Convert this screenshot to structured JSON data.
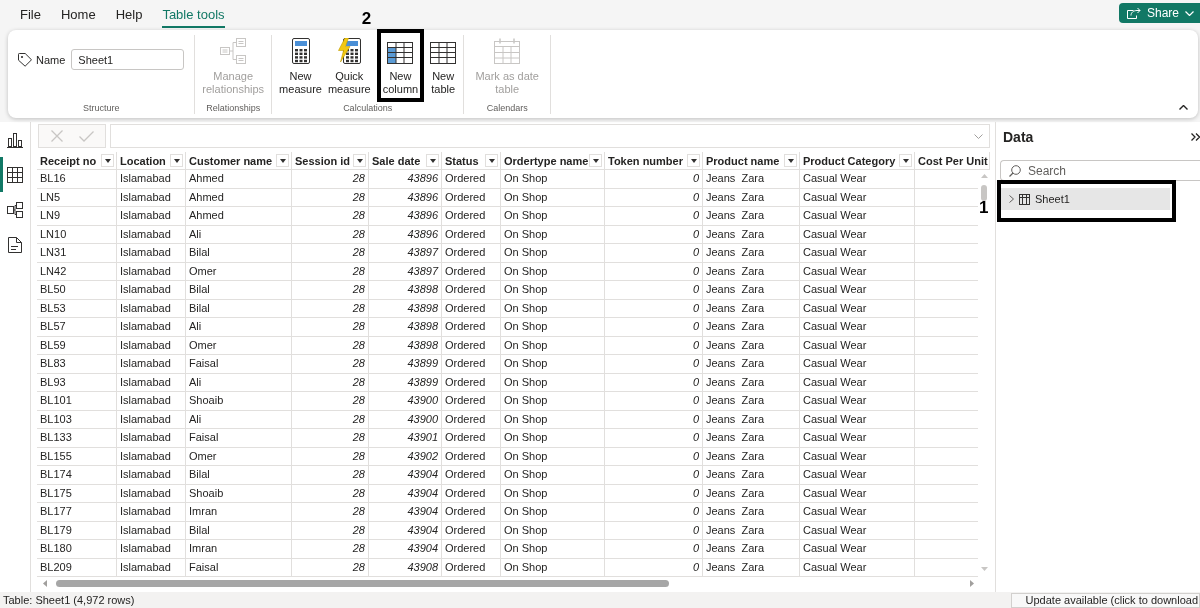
{
  "menu_tabs": [
    {
      "label": "File",
      "selected": false
    },
    {
      "label": "Home",
      "selected": false
    },
    {
      "label": "Help",
      "selected": false
    },
    {
      "label": "Table tools",
      "selected": true
    }
  ],
  "share_button": {
    "label": "Share"
  },
  "ribbon": {
    "groups": [
      {
        "title": "Structure",
        "kind": "field",
        "field": {
          "label": "Name",
          "value": "Sheet1"
        }
      },
      {
        "title": "Relationships",
        "kind": "buttons",
        "buttons": [
          {
            "kind": "relationships",
            "label": "Manage relationships",
            "disabled": true
          }
        ]
      },
      {
        "title": "Calculations",
        "kind": "buttons",
        "buttons": [
          {
            "kind": "measure",
            "label": "New measure",
            "disabled": false
          },
          {
            "kind": "quick",
            "label": "Quick measure",
            "disabled": false
          },
          {
            "kind": "column",
            "label": "New column",
            "disabled": false,
            "annotation": "2"
          },
          {
            "kind": "table",
            "label": "New table",
            "disabled": false
          }
        ]
      },
      {
        "title": "Calendars",
        "kind": "buttons",
        "buttons": [
          {
            "kind": "calendar",
            "label": "Mark as date table",
            "disabled": true
          }
        ]
      }
    ]
  },
  "views": [
    {
      "kind": "report",
      "selected": false
    },
    {
      "kind": "table",
      "selected": true
    },
    {
      "kind": "model",
      "selected": false
    },
    {
      "kind": "dax",
      "selected": false
    }
  ],
  "formula_bar": {
    "buttons": [
      {
        "kind": "cancel",
        "disabled": true
      },
      {
        "kind": "commit",
        "disabled": true
      }
    ]
  },
  "table": {
    "columns": [
      {
        "label": "Receipt no",
        "kind": "text",
        "filter_button": true
      },
      {
        "label": "Location",
        "kind": "text",
        "filter_button": true
      },
      {
        "label": "Customer name",
        "kind": "text",
        "filter_button": true
      },
      {
        "label": "Session id",
        "kind": "number",
        "filter_button": true
      },
      {
        "label": "Sale date",
        "kind": "number",
        "filter_button": true
      },
      {
        "label": "Status",
        "kind": "text",
        "filter_button": true
      },
      {
        "label": "Ordertype name",
        "kind": "text",
        "filter_button": true
      },
      {
        "label": "Token number",
        "kind": "number",
        "filter_button": true
      },
      {
        "label": "Product name",
        "kind": "text",
        "filter_button": true
      },
      {
        "label": "Product Category",
        "kind": "text",
        "filter_button": true
      },
      {
        "label": "Cost Per Unit",
        "kind": "number",
        "filter_button": false
      }
    ],
    "rows": [
      [
        "BL16",
        "Islamabad",
        "Ahmed",
        "28",
        "43896",
        "Ordered",
        "On Shop",
        "0",
        "Jeans  Zara",
        "Casual Wear"
      ],
      [
        "LN5",
        "Islamabad",
        "Ahmed",
        "28",
        "43896",
        "Ordered",
        "On Shop",
        "0",
        "Jeans  Zara",
        "Casual Wear"
      ],
      [
        "LN9",
        "Islamabad",
        "Ahmed",
        "28",
        "43896",
        "Ordered",
        "On Shop",
        "0",
        "Jeans  Zara",
        "Casual Wear"
      ],
      [
        "LN10",
        "Islamabad",
        "Ali",
        "28",
        "43896",
        "Ordered",
        "On Shop",
        "0",
        "Jeans  Zara",
        "Casual Wear"
      ],
      [
        "LN31",
        "Islamabad",
        "Bilal",
        "28",
        "43897",
        "Ordered",
        "On Shop",
        "0",
        "Jeans  Zara",
        "Casual Wear"
      ],
      [
        "LN42",
        "Islamabad",
        "Omer",
        "28",
        "43897",
        "Ordered",
        "On Shop",
        "0",
        "Jeans  Zara",
        "Casual Wear"
      ],
      [
        "BL50",
        "Islamabad",
        "Bilal",
        "28",
        "43898",
        "Ordered",
        "On Shop",
        "0",
        "Jeans  Zara",
        "Casual Wear"
      ],
      [
        "BL53",
        "Islamabad",
        "Bilal",
        "28",
        "43898",
        "Ordered",
        "On Shop",
        "0",
        "Jeans  Zara",
        "Casual Wear"
      ],
      [
        "BL57",
        "Islamabad",
        "Ali",
        "28",
        "43898",
        "Ordered",
        "On Shop",
        "0",
        "Jeans  Zara",
        "Casual Wear"
      ],
      [
        "BL59",
        "Islamabad",
        "Omer",
        "28",
        "43898",
        "Ordered",
        "On Shop",
        "0",
        "Jeans  Zara",
        "Casual Wear"
      ],
      [
        "BL83",
        "Islamabad",
        "Faisal",
        "28",
        "43899",
        "Ordered",
        "On Shop",
        "0",
        "Jeans  Zara",
        "Casual Wear"
      ],
      [
        "BL93",
        "Islamabad",
        "Ali",
        "28",
        "43899",
        "Ordered",
        "On Shop",
        "0",
        "Jeans  Zara",
        "Casual Wear"
      ],
      [
        "BL101",
        "Islamabad",
        "Shoaib",
        "28",
        "43900",
        "Ordered",
        "On Shop",
        "0",
        "Jeans  Zara",
        "Casual Wear"
      ],
      [
        "BL103",
        "Islamabad",
        "Ali",
        "28",
        "43900",
        "Ordered",
        "On Shop",
        "0",
        "Jeans  Zara",
        "Casual Wear"
      ],
      [
        "BL133",
        "Islamabad",
        "Faisal",
        "28",
        "43901",
        "Ordered",
        "On Shop",
        "0",
        "Jeans  Zara",
        "Casual Wear"
      ],
      [
        "BL155",
        "Islamabad",
        "Omer",
        "28",
        "43902",
        "Ordered",
        "On Shop",
        "0",
        "Jeans  Zara",
        "Casual Wear"
      ],
      [
        "BL174",
        "Islamabad",
        "Bilal",
        "28",
        "43904",
        "Ordered",
        "On Shop",
        "0",
        "Jeans  Zara",
        "Casual Wear"
      ],
      [
        "BL175",
        "Islamabad",
        "Shoaib",
        "28",
        "43904",
        "Ordered",
        "On Shop",
        "0",
        "Jeans  Zara",
        "Casual Wear"
      ],
      [
        "BL177",
        "Islamabad",
        "Imran",
        "28",
        "43904",
        "Ordered",
        "On Shop",
        "0",
        "Jeans  Zara",
        "Casual Wear"
      ],
      [
        "BL179",
        "Islamabad",
        "Bilal",
        "28",
        "43904",
        "Ordered",
        "On Shop",
        "0",
        "Jeans  Zara",
        "Casual Wear"
      ],
      [
        "BL180",
        "Islamabad",
        "Imran",
        "28",
        "43904",
        "Ordered",
        "On Shop",
        "0",
        "Jeans  Zara",
        "Casual Wear"
      ],
      [
        "BL209",
        "Islamabad",
        "Faisal",
        "28",
        "43908",
        "Ordered",
        "On Shop",
        "0",
        "Jeans  Zara",
        "Casual Wear"
      ]
    ]
  },
  "data_pane": {
    "title": "Data",
    "search": {
      "placeholder": "Search"
    },
    "tables": [
      {
        "label": "Sheet1",
        "expanded": false,
        "selected": true,
        "annotation": "1"
      }
    ]
  },
  "status_bar": {
    "text": "Table: Sheet1 (4,972 rows)",
    "update_button": "Update available (click to download"
  }
}
